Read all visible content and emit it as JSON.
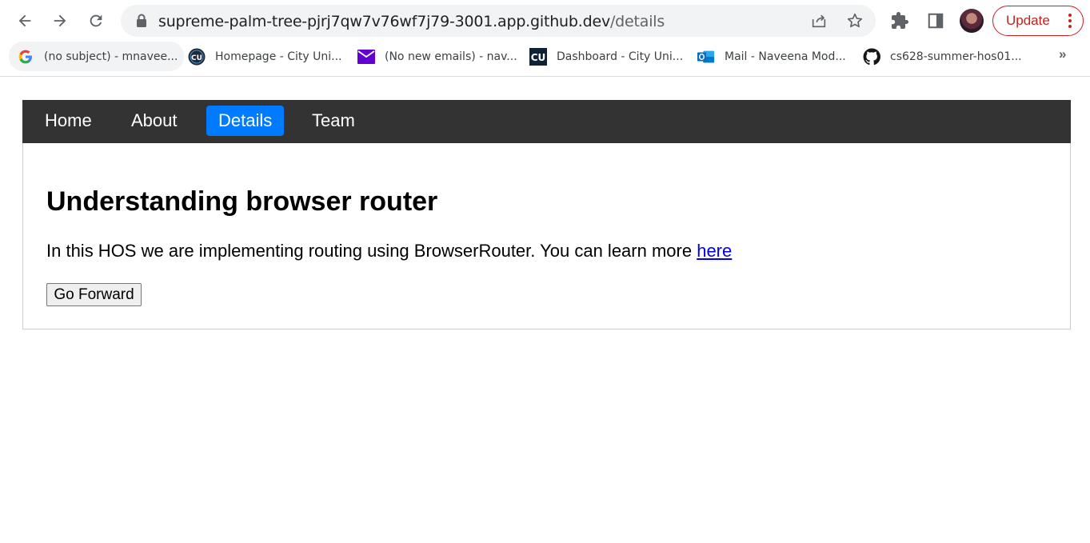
{
  "browser": {
    "url_host": "supreme-palm-tree-pjrj7qw7v76wf7j79-3001.app.github.dev",
    "url_path": "/details",
    "update_label": "Update",
    "accent_color": "#c5221f"
  },
  "bookmarks": [
    {
      "label": "(no subject) - mnavee...",
      "icon": "google-icon"
    },
    {
      "label": "Homepage - City Uni...",
      "icon": "cu-round-icon"
    },
    {
      "label": "(No new emails) - nav...",
      "icon": "mail-icon"
    },
    {
      "label": "Dashboard - City Uni...",
      "icon": "cu-square-icon"
    },
    {
      "label": "Mail - Naveena Mod...",
      "icon": "outlook-icon"
    },
    {
      "label": "cs628-summer-hos01...",
      "icon": "github-icon"
    }
  ],
  "nav": {
    "items": [
      {
        "label": "Home",
        "active": false
      },
      {
        "label": "About",
        "active": false
      },
      {
        "label": "Details",
        "active": true
      },
      {
        "label": "Team",
        "active": false
      }
    ],
    "background": "#333333",
    "active_color": "#007bff"
  },
  "main": {
    "title": "Understanding browser router",
    "paragraph": "In this HOS we are implementing routing using BrowserRouter. You can learn more ",
    "link_label": "here",
    "button_label": "Go Forward"
  }
}
